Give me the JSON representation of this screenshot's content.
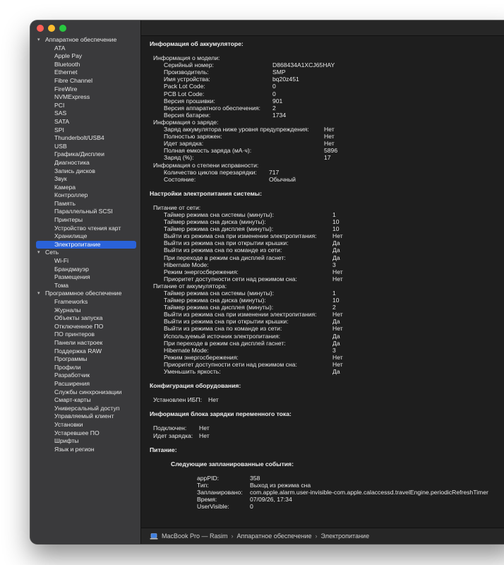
{
  "sidebar": {
    "categories": [
      {
        "label": "Аппаратное обеспечение",
        "items": [
          "ATA",
          "Apple Pay",
          "Bluetooth",
          "Ethernet",
          "Fibre Channel",
          "FireWire",
          "NVMExpress",
          "PCI",
          "SAS",
          "SATA",
          "SPI",
          "Thunderbolt/USB4",
          "USB",
          "Графика/Дисплеи",
          "Диагностика",
          "Запись дисков",
          "Звук",
          "Камера",
          "Контроллер",
          "Память",
          "Параллельный SCSI",
          "Принтеры",
          "Устройство чтения карт",
          "Хранилище",
          "Электропитание"
        ]
      },
      {
        "label": "Сеть",
        "items": [
          "Wi-Fi",
          "Брандмауэр",
          "Размещения",
          "Тома"
        ]
      },
      {
        "label": "Программное обеспечение",
        "items": [
          "Frameworks",
          "Журналы",
          "Объекты запуска",
          "Отключенное ПО",
          "ПО принтеров",
          "Панели настроек",
          "Поддержка RAW",
          "Программы",
          "Профили",
          "Разработчик",
          "Расширения",
          "Службы синхронизации",
          "Смарт-карты",
          "Универсальный доступ",
          "Управляемый клиент",
          "Установки",
          "Устаревшее ПО",
          "Шрифты",
          "Язык и регион"
        ]
      }
    ],
    "selected": "Электропитание"
  },
  "battery": {
    "title": "Информация об аккумуляторе:",
    "model_header": "Информация о модели:",
    "model": [
      {
        "k": "Серийный номер:",
        "v": "D868434A1XCJ65HAY"
      },
      {
        "k": "Производитель:",
        "v": "SMP"
      },
      {
        "k": "Имя устройства:",
        "v": "bq20z451"
      },
      {
        "k": "Pack Lot Code:",
        "v": "0"
      },
      {
        "k": "PCB Lot Code:",
        "v": "0"
      },
      {
        "k": "Версия прошивки:",
        "v": "901"
      },
      {
        "k": "Версия аппаратного обеспечения:",
        "v": "2"
      },
      {
        "k": "Версия батареи:",
        "v": "1734"
      }
    ],
    "charge_header": "Информация о заряде:",
    "charge": [
      {
        "k": "Заряд аккумулятора ниже уровня предупреждения:",
        "v": "Нет"
      },
      {
        "k": "Полностью заряжен:",
        "v": "Нет"
      },
      {
        "k": "Идет зарядка:",
        "v": "Нет"
      },
      {
        "k": "Полная емкость заряда (мА·ч):",
        "v": "5896"
      },
      {
        "k": "Заряд (%):",
        "v": "17"
      }
    ],
    "health_header": "Информация о степени исправности:",
    "health": [
      {
        "k": "Количество циклов перезарядки:",
        "v": "717"
      },
      {
        "k": "Состояние:",
        "v": "Обычный"
      }
    ]
  },
  "power": {
    "title": "Настройки электропитания системы:",
    "ac_header": "Питание от сети:",
    "ac": [
      {
        "k": "Таймер режима сна системы (минуты):",
        "v": "1"
      },
      {
        "k": "Таймер режима сна диска (минуты):",
        "v": "10"
      },
      {
        "k": "Таймер режима сна дисплея (минуты):",
        "v": "10"
      },
      {
        "k": "Выйти из режима сна при изменении электропитания:",
        "v": "Нет"
      },
      {
        "k": "Выйти из режима сна при открытии крышки:",
        "v": "Да"
      },
      {
        "k": "Выйти из режима сна по команде из сети:",
        "v": "Да"
      },
      {
        "k": "При переходе в режим сна дисплей гаснет:",
        "v": "Да"
      },
      {
        "k": "Hibernate Mode:",
        "v": "3"
      },
      {
        "k": "Режим энергосбережения:",
        "v": "Нет"
      },
      {
        "k": "Приоритет доступности сети над режимом сна:",
        "v": "Нет"
      }
    ],
    "battery_header": "Питание от аккумулятора:",
    "battery": [
      {
        "k": "Таймер режима сна системы (минуты):",
        "v": "1"
      },
      {
        "k": "Таймер режима сна диска (минуты):",
        "v": "10"
      },
      {
        "k": "Таймер режима сна дисплея (минуты):",
        "v": "2"
      },
      {
        "k": "Выйти из режима сна при изменении электропитания:",
        "v": "Нет"
      },
      {
        "k": "Выйти из режима сна при открытии крышки:",
        "v": "Да"
      },
      {
        "k": "Выйти из режима сна по команде из сети:",
        "v": "Нет"
      },
      {
        "k": "Используемый источник электропитания:",
        "v": "Да"
      },
      {
        "k": "При переходе в режим сна дисплей гаснет:",
        "v": "Да"
      },
      {
        "k": "Hibernate Mode:",
        "v": "3"
      },
      {
        "k": "Режим энергосбережения:",
        "v": "Нет"
      },
      {
        "k": "Приоритет доступности сети над режимом сна:",
        "v": "Нет"
      },
      {
        "k": "Уменьшить яркость:",
        "v": "Да"
      }
    ]
  },
  "hardware": {
    "title": "Конфигурация оборудования:",
    "rows": [
      {
        "k": "Установлен ИБП:",
        "v": "Нет"
      }
    ]
  },
  "charger": {
    "title": "Информация блока зарядки переменного тока:",
    "rows": [
      {
        "k": "Подключен:",
        "v": "Нет"
      },
      {
        "k": "Идет зарядка:",
        "v": "Нет"
      }
    ]
  },
  "supply": {
    "title": "Питание:",
    "events_header": "Следующие запланированные события:",
    "events": [
      {
        "k": "appPID:",
        "v": "358"
      },
      {
        "k": "Тип:",
        "v": "Выход из режима сна"
      },
      {
        "k": "Запланировано:",
        "v": "com.apple.alarm.user-invisible-com.apple.calaccessd.travelEngine.periodicRefreshTimer"
      },
      {
        "k": "Время:",
        "v": "07/09/26, 17:34"
      },
      {
        "k": "UserVisible:",
        "v": "0"
      }
    ]
  },
  "statusbar": {
    "icon": "laptop-icon",
    "crumbs": [
      "MacBook Pro — Rasim",
      "Аппаратное обеспечение",
      "Электропитание"
    ],
    "separator": "›"
  }
}
